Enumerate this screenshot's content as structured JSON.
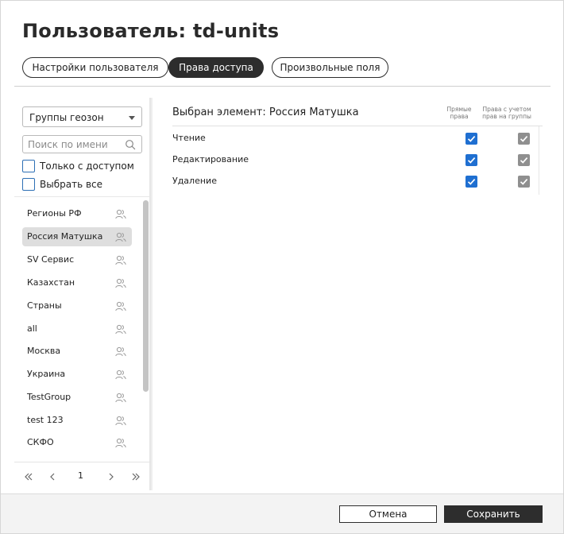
{
  "dialog": {
    "title": "Пользователь: td-units"
  },
  "tabs": [
    {
      "label": "Настройки пользователя",
      "active": false
    },
    {
      "label": "Права доступа",
      "active": true
    },
    {
      "label": "Произвольные поля",
      "active": false
    }
  ],
  "left": {
    "select_value": "Группы геозон",
    "search_placeholder": "Поиск по имени",
    "only_with_access": "Только с доступом",
    "select_all": "Выбрать все",
    "items": [
      {
        "label": "Регионы РФ",
        "icon": "group-users-icon"
      },
      {
        "label": "Россия Матушка",
        "icon": "group-users-icon",
        "selected": true
      },
      {
        "label": "SV Сервис",
        "icon": "group-users-icon"
      },
      {
        "label": "Казахстан",
        "icon": "group-users-icon"
      },
      {
        "label": "Страны",
        "icon": "group-users-icon"
      },
      {
        "label": "all",
        "icon": "group-users-icon"
      },
      {
        "label": "Москва",
        "icon": "group-users-icon"
      },
      {
        "label": "Украина",
        "icon": "group-users-icon"
      },
      {
        "label": "TestGroup",
        "icon": "group-users-icon"
      },
      {
        "label": "test 123",
        "icon": "group-users-icon"
      },
      {
        "label": "СКФО",
        "icon": "group-users-icon"
      }
    ],
    "pager": {
      "page": "1"
    }
  },
  "right": {
    "selected_title": "Выбран элемент: Россия Матушка",
    "col_direct": "Прямые права",
    "col_groups": "Права с учетом прав на группы",
    "permissions": [
      {
        "label": "Чтение",
        "direct": true,
        "group": true
      },
      {
        "label": "Редактирование",
        "direct": true,
        "group": true
      },
      {
        "label": "Удаление",
        "direct": true,
        "group": true
      }
    ]
  },
  "footer": {
    "cancel": "Отмена",
    "save": "Сохранить"
  },
  "colors": {
    "accent": "#1f6fd1",
    "dark": "#2d2d2d",
    "disabled_check": "#8f8f8f"
  }
}
